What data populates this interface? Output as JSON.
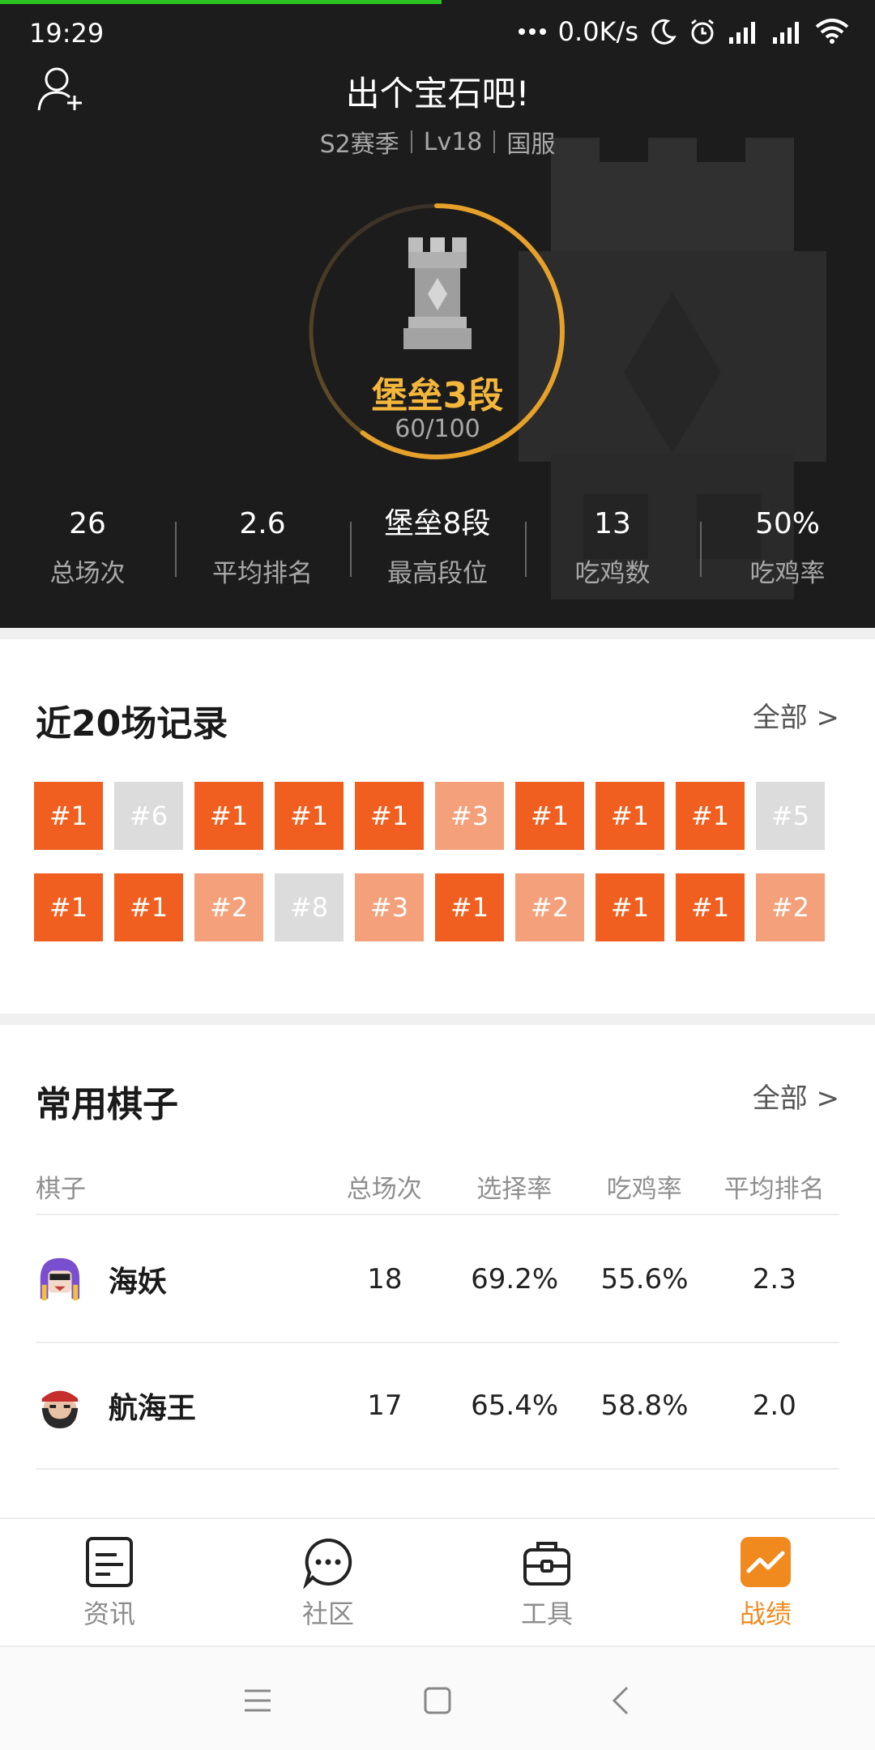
{
  "status_bar": {
    "time": "19:29",
    "network_speed": "0.0K/s",
    "icons": [
      "more-dots-icon",
      "moon-icon",
      "alarm-icon",
      "signal-icon",
      "signal-icon",
      "wifi-icon"
    ]
  },
  "header": {
    "title": "出个宝石吧!",
    "season": "S2赛季",
    "level": "Lv18",
    "server": "国服"
  },
  "rank": {
    "name": "堡垒3段",
    "progress_text": "60/100",
    "progress_fraction": 0.6,
    "ring_color": "#e6a12a"
  },
  "stats": [
    {
      "value": "26",
      "label": "总场次"
    },
    {
      "value": "2.6",
      "label": "平均排名"
    },
    {
      "value": "堡垒8段",
      "label": "最高段位"
    },
    {
      "value": "13",
      "label": "吃鸡数"
    },
    {
      "value": "50%",
      "label": "吃鸡率"
    }
  ],
  "recent": {
    "title": "近20场记录",
    "all_link": "全部 >",
    "rows": [
      [
        "#1",
        "#6",
        "#1",
        "#1",
        "#1",
        "#3",
        "#1",
        "#1",
        "#1",
        "#5"
      ],
      [
        "#1",
        "#1",
        "#2",
        "#8",
        "#3",
        "#1",
        "#2",
        "#1",
        "#1",
        "#2"
      ]
    ]
  },
  "pieces": {
    "title": "常用棋子",
    "all_link": "全部 >",
    "columns": [
      "棋子",
      "总场次",
      "选择率",
      "吃鸡率",
      "平均排名"
    ],
    "rows": [
      {
        "name": "海妖",
        "games": "18",
        "pick_rate": "69.2%",
        "win_rate": "55.6%",
        "avg_rank": "2.3"
      },
      {
        "name": "航海王",
        "games": "17",
        "pick_rate": "65.4%",
        "win_rate": "58.8%",
        "avg_rank": "2.0"
      }
    ]
  },
  "bottom_nav": [
    {
      "label": "资讯",
      "icon": "news-icon"
    },
    {
      "label": "社区",
      "icon": "chat-icon"
    },
    {
      "label": "工具",
      "icon": "toolbox-icon"
    },
    {
      "label": "战绩",
      "icon": "stats-icon",
      "active": true
    }
  ],
  "colors": {
    "accent": "#f08a1e",
    "first_place": "#f05f1f",
    "top_place": "#f4a07a",
    "low_place": "#dcdcdc",
    "rank_name": "#f5b73b"
  }
}
